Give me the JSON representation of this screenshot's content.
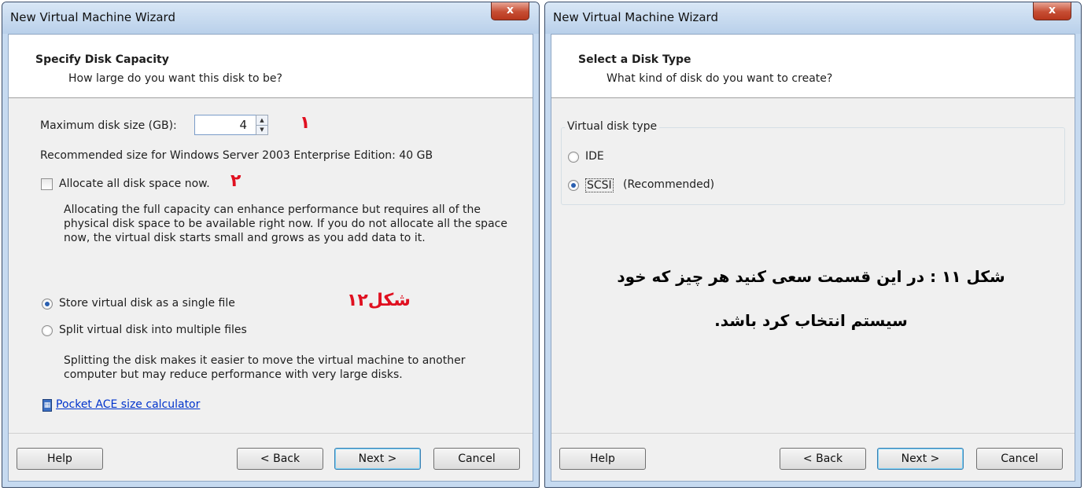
{
  "left": {
    "window_title": "New Virtual Machine Wizard",
    "close_symbol": "x",
    "header_title": "Specify Disk Capacity",
    "header_sub": "How large do you want this disk to be?",
    "max_disk_label": "Maximum disk size (GB):",
    "max_disk_value": "4",
    "recommended": "Recommended size for Windows Server 2003 Enterprise Edition: 40 GB",
    "allocate_label": "Allocate all disk space now.",
    "allocate_checked": false,
    "allocate_desc": "Allocating the full capacity can enhance performance but requires all of the physical disk space to be available right now. If you do not allocate all the space now, the virtual disk starts small and grows as you add data to it.",
    "single_file_label": "Store virtual disk as a single file",
    "multi_file_label": "Split virtual disk into multiple files",
    "split_desc": "Splitting the disk makes it easier to move the virtual machine to another computer but may reduce performance with very large disks.",
    "calculator_link": "Pocket ACE size calculator",
    "annotations": {
      "one": "۱",
      "two": "۲",
      "figure": "شکل۱۲"
    },
    "buttons": {
      "help": "Help",
      "back": "< Back",
      "next": "Next >",
      "cancel": "Cancel"
    }
  },
  "right": {
    "window_title": "New Virtual Machine Wizard",
    "close_symbol": "x",
    "header_title": "Select a Disk Type",
    "header_sub": "What kind of disk do you want to create?",
    "group_label": "Virtual disk type",
    "ide_label": "IDE",
    "scsi_label": "SCSI",
    "scsi_suffix": "(Recommended)",
    "selected": "SCSI",
    "caption_line1": "شکل ۱۱ : در این قسمت سعی کنید هر چیز که خود",
    "caption_line2": "سیستم انتخاب کرد باشد.",
    "buttons": {
      "help": "Help",
      "back": "< Back",
      "next": "Next >",
      "cancel": "Cancel"
    }
  },
  "colors": {
    "accent_red": "#e01020",
    "link_blue": "#0033cc",
    "radio_fill": "#2a5fb0"
  }
}
